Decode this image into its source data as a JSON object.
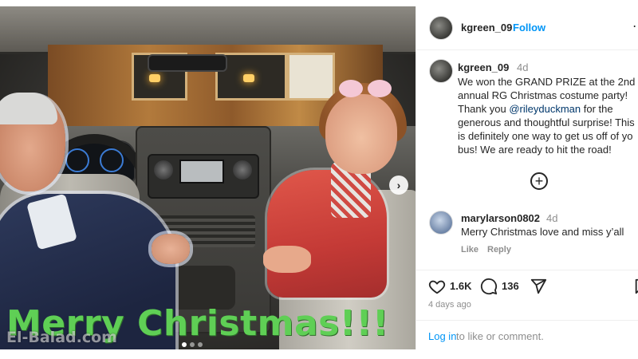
{
  "photo": {
    "overlay_text": "Merry Christmas!!!",
    "watermark": "El-Balad.com",
    "carousel_dots": 3,
    "active_dot": 1
  },
  "header": {
    "username": "kgreen_09",
    "separator": "·",
    "follow_label": "Follow",
    "more_icon": "ellipsis-icon"
  },
  "caption": {
    "username": "kgreen_09",
    "time": "4d",
    "lines": [
      "We won the GRAND PRIZE at the 2nd",
      "annual RG Christmas costume party!",
      "Thank you ",
      " for the",
      "generous and thoughtful surprise! This",
      "is definitely one way to get us off of yo",
      "bus! We are ready to hit the road!"
    ],
    "mention": "@rileyduckman"
  },
  "load_more_icon": "plus-circle-icon",
  "comment": {
    "username": "marylarson0802",
    "time": "4d",
    "text": "Merry Christmas love and miss y’all",
    "like_label": "Like",
    "reply_label": "Reply"
  },
  "actions": {
    "likes": "1.6K",
    "comments": "136",
    "posted_ago": "4 days ago"
  },
  "footer": {
    "login_label": "Log in",
    "login_rest": "to like or comment."
  },
  "colors": {
    "link_blue": "#0095f6",
    "mention": "#00376b",
    "overlay_green": "#5fcf55"
  }
}
